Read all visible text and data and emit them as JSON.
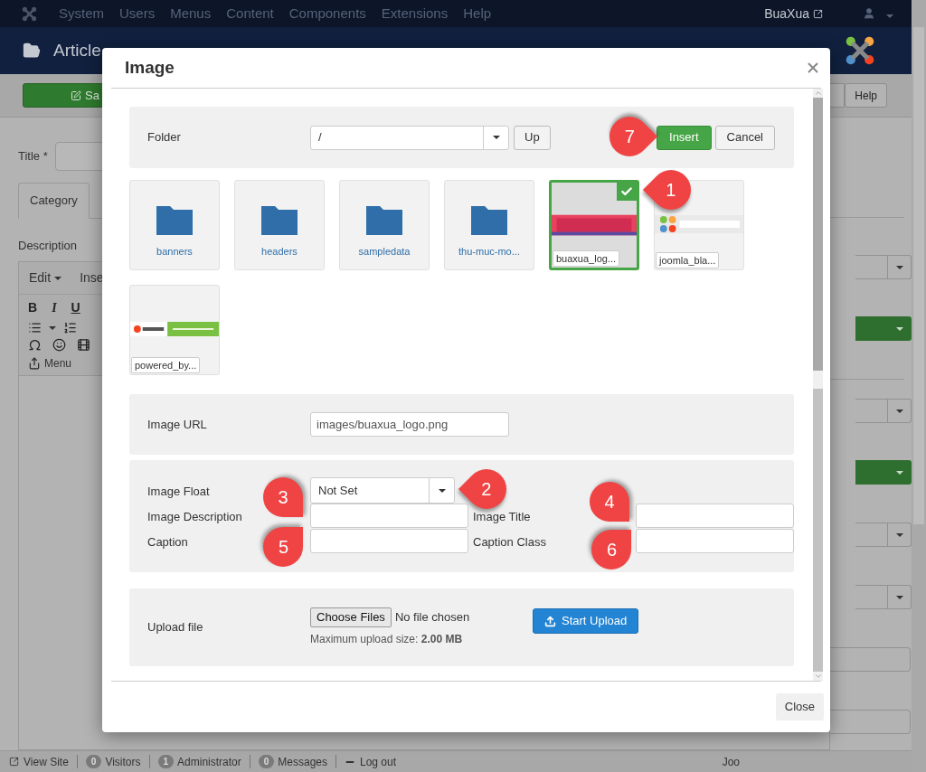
{
  "topbar": {
    "menu": [
      "System",
      "Users",
      "Menus",
      "Content",
      "Components",
      "Extensions",
      "Help"
    ],
    "user_link": "BuaXua"
  },
  "header": {
    "title": "Article"
  },
  "toolbar": {
    "save": "Sa",
    "help": "Help"
  },
  "form": {
    "title_label": "Title *",
    "tabs": [
      {
        "label": "Category",
        "selected": true
      }
    ],
    "description_label": "Description",
    "editor_menu": [
      "Edit",
      "Inse"
    ],
    "editor_buttons": [
      "B",
      "I",
      "U"
    ],
    "menu_button": "Menu"
  },
  "right_controls": [
    {
      "kind": "divider"
    },
    {
      "kind": "select"
    },
    {
      "kind": "select-green"
    },
    {
      "kind": "divider"
    },
    {
      "kind": "select"
    },
    {
      "kind": "select-green"
    },
    {
      "kind": "select"
    },
    {
      "kind": "select"
    },
    {
      "kind": "input"
    },
    {
      "kind": "input"
    }
  ],
  "modal": {
    "title": "Image",
    "folder": {
      "label": "Folder",
      "value": "/",
      "up": "Up"
    },
    "insert": "Insert",
    "cancel": "Cancel",
    "items": [
      {
        "kind": "folder",
        "name": "banners",
        "selected": false
      },
      {
        "kind": "folder",
        "name": "headers",
        "selected": false
      },
      {
        "kind": "folder",
        "name": "sampledata",
        "selected": false
      },
      {
        "kind": "folder",
        "name": "thu-muc-mo...",
        "selected": false
      },
      {
        "name": "buaxua_log...",
        "selected": true
      },
      {
        "name": "joomla_bla...",
        "selected": false
      },
      {
        "name": "powered_by...",
        "selected": false
      }
    ],
    "url": {
      "label": "Image URL",
      "value": "images/buaxua_logo.png"
    },
    "float": {
      "label": "Image Float",
      "value": "Not Set"
    },
    "description": {
      "label": "Image Description"
    },
    "image_title": {
      "label": "Image Title"
    },
    "caption": {
      "label": "Caption"
    },
    "caption_class": {
      "label": "Caption Class"
    },
    "upload": {
      "label": "Upload file",
      "choose": "Choose Files",
      "status": "No file chosen",
      "note": "Maximum upload size: **2.00 MB**",
      "start": "Start Upload"
    },
    "close": "Close"
  },
  "status_bar": [
    {
      "kind": "link",
      "label": "View Site"
    },
    {
      "kind": "count",
      "count": "0",
      "label": "Visitors"
    },
    {
      "kind": "count",
      "count": "1",
      "label": "Administrator"
    },
    {
      "kind": "count",
      "count": "0",
      "label": "Messages"
    },
    {
      "kind": "logout",
      "label": "Log out"
    },
    {
      "kind": "text",
      "label": "Joo"
    }
  ],
  "callouts": [
    "1",
    "7",
    "2",
    "3",
    "4",
    "5",
    "6"
  ]
}
